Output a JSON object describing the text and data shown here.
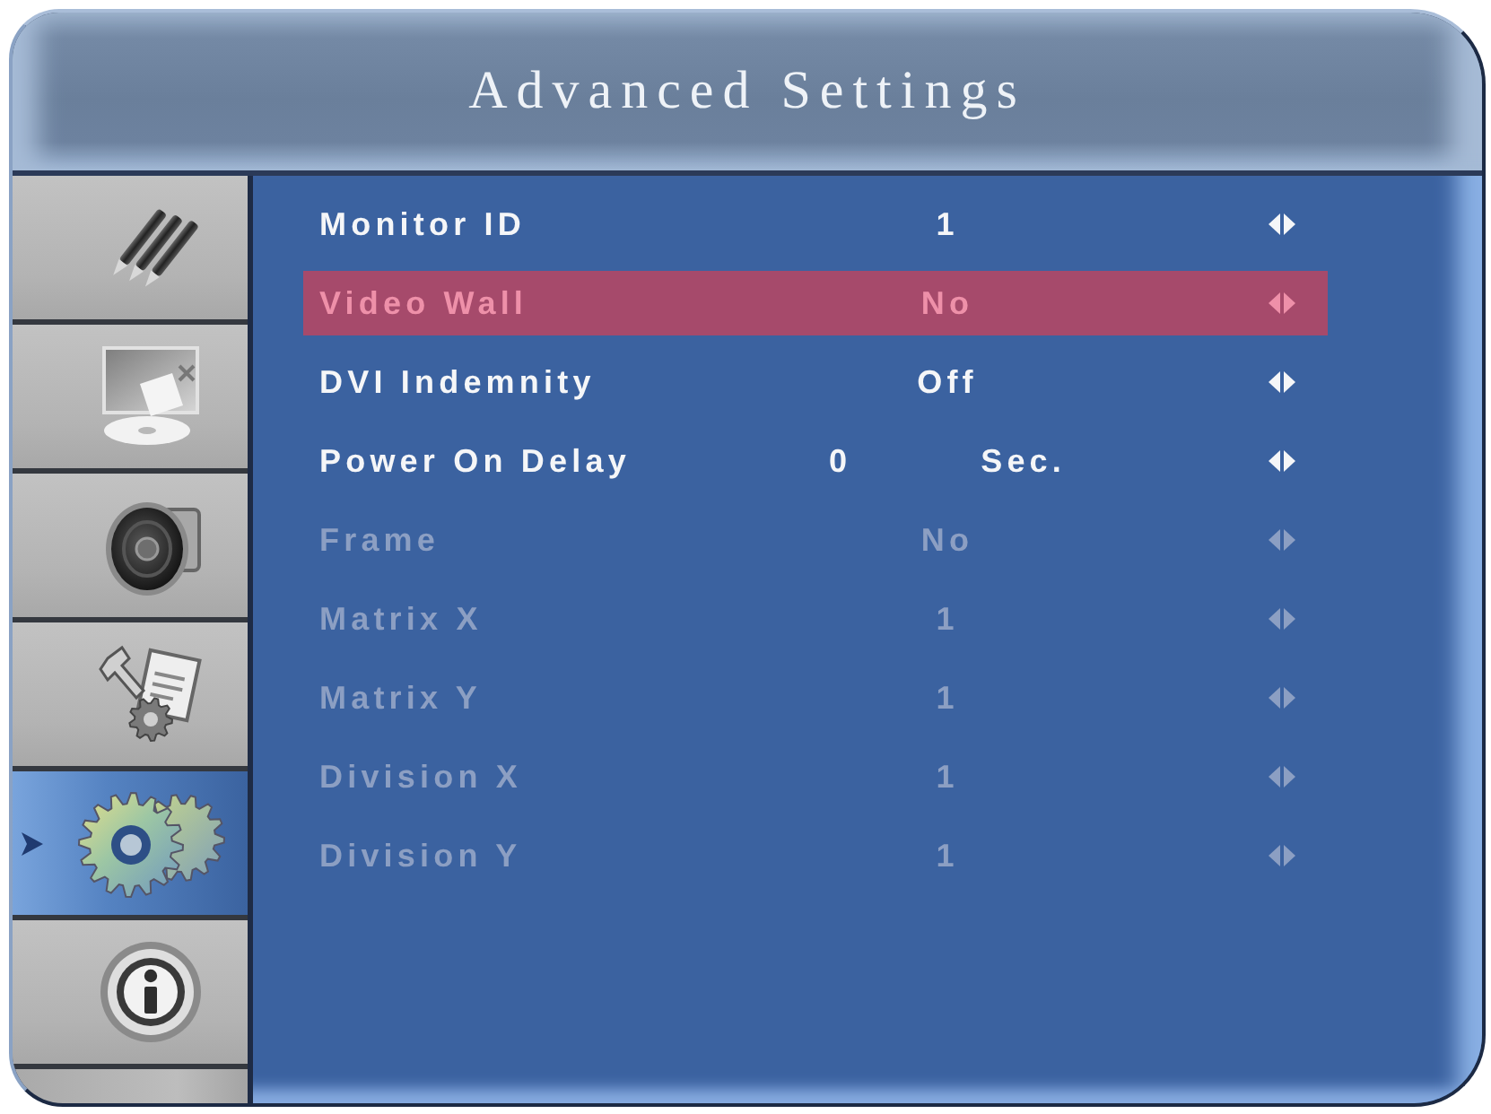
{
  "window": {
    "title": "Advanced Settings"
  },
  "sidebar": {
    "tabs": [
      {
        "selected": false
      },
      {
        "selected": false
      },
      {
        "selected": false
      },
      {
        "selected": false
      },
      {
        "selected": true
      },
      {
        "selected": false
      }
    ]
  },
  "settings": [
    {
      "label": "Monitor ID",
      "value": "1",
      "selected": false,
      "disabled": false
    },
    {
      "label": "Video Wall",
      "value": "No",
      "selected": true,
      "disabled": false
    },
    {
      "label": "DVI Indemnity",
      "value": "Off",
      "selected": false,
      "disabled": false
    },
    {
      "label": "Power On Delay",
      "value": "0",
      "unit": "Sec.",
      "selected": false,
      "disabled": false
    },
    {
      "label": "Frame",
      "value": "No",
      "selected": false,
      "disabled": true
    },
    {
      "label": "Matrix X",
      "value": "1",
      "selected": false,
      "disabled": true
    },
    {
      "label": "Matrix Y",
      "value": "1",
      "selected": false,
      "disabled": true
    },
    {
      "label": "Division X",
      "value": "1",
      "selected": false,
      "disabled": true
    },
    {
      "label": "Division Y",
      "value": "1",
      "selected": false,
      "disabled": true
    }
  ]
}
